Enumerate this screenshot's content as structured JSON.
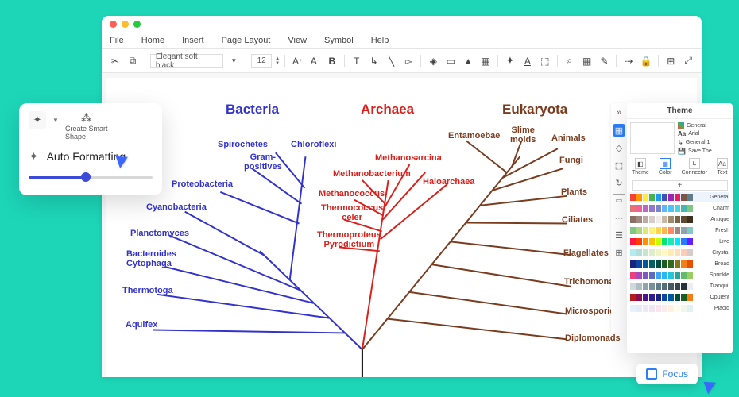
{
  "menubar": {
    "file": "File",
    "home": "Home",
    "insert": "Insert",
    "pageLayout": "Page Layout",
    "view": "View",
    "symbol": "Symbol",
    "help": "Help"
  },
  "toolbar": {
    "font": "Elegant soft black",
    "size": "12"
  },
  "domains": {
    "bacteria": "Bacteria",
    "archaea": "Archaea",
    "eukaryota": "Eukaryota"
  },
  "bacteria": {
    "spirochetes": "Spirochetes",
    "chloroflexi": "Chloroflexi",
    "gram": "Gram-\npositives",
    "proteo": "Proteobacteria",
    "cyano": "Cyanobacteria",
    "plancto": "Planctomyces",
    "bactero": "Bacteroides\nCytophaga",
    "thermo": "Thermotoga",
    "aquifex": "Aquifex"
  },
  "archaea": {
    "methsarc": "Methanosarcina",
    "methbact": "Methanobacterium",
    "methcocc": "Methanococcus",
    "thermocel": "Thermococcus\nceler",
    "thermoprot": "Thermoproteus\nPyrodictium",
    "haloarch": "Haloarchaea",
    "entamo": "Entamoebae"
  },
  "eukaryota": {
    "slime": "Slime\nmolds",
    "animals": "Animals",
    "fungi": "Fungi",
    "plants": "Plants",
    "ciliates": "Ciliates",
    "flagel": "Flagellates",
    "trichom": "Trichomonads",
    "microsp": "Microsporidia",
    "diplo": "Diplomonads"
  },
  "popover": {
    "createSmart": "Create Smart\nShape",
    "autoFormatting": "Auto Formatting"
  },
  "themePanel": {
    "title": "Theme",
    "optGeneral": "General",
    "optArial": "Arial",
    "optGeneral1": "General 1",
    "optSave": "Save The…",
    "catTheme": "Theme",
    "catColor": "Color",
    "catConnector": "Connector",
    "catText": "Text",
    "palettes": [
      {
        "name": "General",
        "c": [
          "#f44336",
          "#ff9800",
          "#ffeb3b",
          "#4caf50",
          "#2196f3",
          "#3f51b5",
          "#9c27b0",
          "#e91e63",
          "#795548",
          "#607d8b"
        ],
        "sel": true
      },
      {
        "name": "Charm",
        "c": [
          "#e57373",
          "#f06292",
          "#ba68c8",
          "#9575cd",
          "#7986cb",
          "#64b5f6",
          "#4fc3f7",
          "#4dd0e1",
          "#4db6ac",
          "#81c784"
        ]
      },
      {
        "name": "Antique",
        "c": [
          "#8d6e63",
          "#a1887f",
          "#bcaaa4",
          "#d7ccc8",
          "#efebe9",
          "#c5b8a5",
          "#a08a6e",
          "#7b6143",
          "#5d4a32",
          "#3e3020"
        ]
      },
      {
        "name": "Fresh",
        "c": [
          "#81c784",
          "#aed581",
          "#dce775",
          "#fff176",
          "#ffd54f",
          "#ffb74d",
          "#ff8a65",
          "#a1887f",
          "#90a4ae",
          "#80cbc4"
        ]
      },
      {
        "name": "Live",
        "c": [
          "#ff1744",
          "#ff3d00",
          "#ff9100",
          "#ffc400",
          "#c6ff00",
          "#00e676",
          "#1de9b6",
          "#00e5ff",
          "#2979ff",
          "#651fff"
        ]
      },
      {
        "name": "Crystal",
        "c": [
          "#b2ebf2",
          "#b2dfdb",
          "#c8e6c9",
          "#dcedc8",
          "#f0f4c3",
          "#fff9c4",
          "#ffecb3",
          "#ffe0b2",
          "#ffccbc",
          "#d7ccc8"
        ]
      },
      {
        "name": "Broad",
        "c": [
          "#1a237e",
          "#0d47a1",
          "#01579b",
          "#006064",
          "#004d40",
          "#1b5e20",
          "#33691e",
          "#827717",
          "#f57f17",
          "#e65100"
        ]
      },
      {
        "name": "Sprinkle",
        "c": [
          "#ec407a",
          "#ab47bc",
          "#7e57c2",
          "#5c6bc0",
          "#42a5f5",
          "#29b6f6",
          "#26c6da",
          "#26a69a",
          "#66bb6a",
          "#9ccc65"
        ]
      },
      {
        "name": "Tranquil",
        "c": [
          "#cfd8dc",
          "#b0bec5",
          "#90a4ae",
          "#78909c",
          "#607d8b",
          "#546e7a",
          "#455a64",
          "#37474f",
          "#263238",
          "#eceff1"
        ]
      },
      {
        "name": "Opulent",
        "c": [
          "#b71c1c",
          "#880e4f",
          "#4a148c",
          "#311b92",
          "#1a237e",
          "#0d47a1",
          "#01579b",
          "#004d40",
          "#1b5e20",
          "#f57f17"
        ]
      },
      {
        "name": "Placid",
        "c": [
          "#e3f2fd",
          "#e8eaf6",
          "#ede7f6",
          "#f3e5f5",
          "#fce4ec",
          "#ffebee",
          "#fff3e0",
          "#fffde7",
          "#f1f8e9",
          "#e0f2f1"
        ]
      }
    ]
  },
  "focus": {
    "label": "Focus"
  }
}
